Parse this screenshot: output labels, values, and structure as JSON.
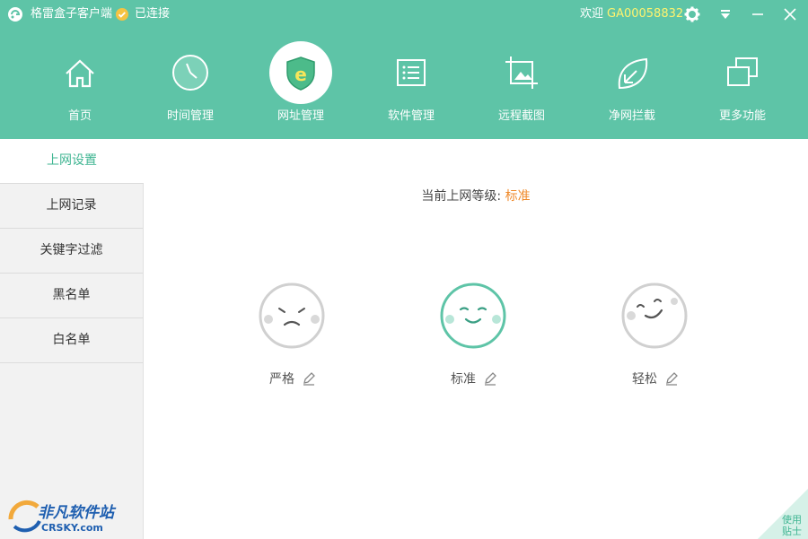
{
  "titlebar": {
    "app_title": "格雷盒子客户端",
    "status": "已连接",
    "welcome": "欢迎",
    "user_id": "GA00058832",
    "icons": [
      "app-logo-icon",
      "check-icon",
      "gear-icon",
      "dropdown-icon",
      "minimize-icon",
      "close-icon"
    ]
  },
  "nav": {
    "items": [
      {
        "label": "首页",
        "icon": "home-icon"
      },
      {
        "label": "时间管理",
        "icon": "clock-icon"
      },
      {
        "label": "网址管理",
        "icon": "shield-e-icon",
        "active": true
      },
      {
        "label": "软件管理",
        "icon": "list-icon"
      },
      {
        "label": "远程截图",
        "icon": "screenshot-icon"
      },
      {
        "label": "净网拦截",
        "icon": "leaf-icon"
      },
      {
        "label": "更多功能",
        "icon": "windows-icon"
      }
    ]
  },
  "sidebar": {
    "items": [
      {
        "label": "上网设置",
        "active": true
      },
      {
        "label": "上网记录"
      },
      {
        "label": "关键字过滤"
      },
      {
        "label": "黑名单"
      },
      {
        "label": "白名单"
      }
    ]
  },
  "main": {
    "level_prefix": "当前上网等级:",
    "level_value": "标准",
    "levels": [
      {
        "label": "严格",
        "face": "sad-face-icon"
      },
      {
        "label": "标准",
        "face": "smile-face-icon",
        "selected": true
      },
      {
        "label": "轻松",
        "face": "wink-face-icon"
      }
    ]
  },
  "tips": {
    "line1": "使用",
    "line2": "贴士"
  },
  "watermark": {
    "cn": "非凡软件站",
    "en": "CRSKY.com"
  },
  "colors": {
    "primary": "#5ec4a7",
    "accent": "#3fb592",
    "orange": "#ef8a2b",
    "userid": "#fff36e"
  }
}
